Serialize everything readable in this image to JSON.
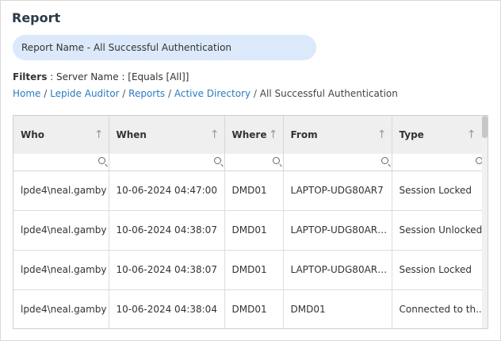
{
  "report": {
    "title": "Report",
    "name_pill": "Report Name - All Successful Authentication"
  },
  "filters": {
    "label": "Filters",
    "value": " : Server Name : [Equals [All]]"
  },
  "breadcrumb": {
    "home": "Home",
    "lepide": "Lepide Auditor",
    "reports": "Reports",
    "ad": "Active Directory",
    "current": "All Successful Authentication",
    "sep": " / "
  },
  "table": {
    "columns": [
      "Who",
      "When",
      "Where",
      "From",
      "Type"
    ],
    "rows": [
      [
        "lpde4\\neal.gamby",
        "10-06-2024 04:47:00",
        "DMD01",
        "LAPTOP-UDG80AR7",
        "Session Locked"
      ],
      [
        "lpde4\\neal.gamby",
        "10-06-2024 04:38:07",
        "DMD01",
        "LAPTOP-UDG80AR7...",
        "Session Unlocked"
      ],
      [
        "lpde4\\neal.gamby",
        "10-06-2024 04:38:07",
        "DMD01",
        "LAPTOP-UDG80AR7...",
        "Session Locked"
      ],
      [
        "lpde4\\neal.gamby",
        "10-06-2024 04:38:04",
        "DMD01",
        "DMD01",
        "Connected to th..."
      ]
    ],
    "sort_icon": "up-arrow-icon",
    "filter_icon": "search-icon"
  },
  "colors": {
    "accent_link": "#2a7bc0",
    "pill_bg": "#dbe9fb",
    "header_bg": "#efefef",
    "title": "#2b3a4a"
  }
}
